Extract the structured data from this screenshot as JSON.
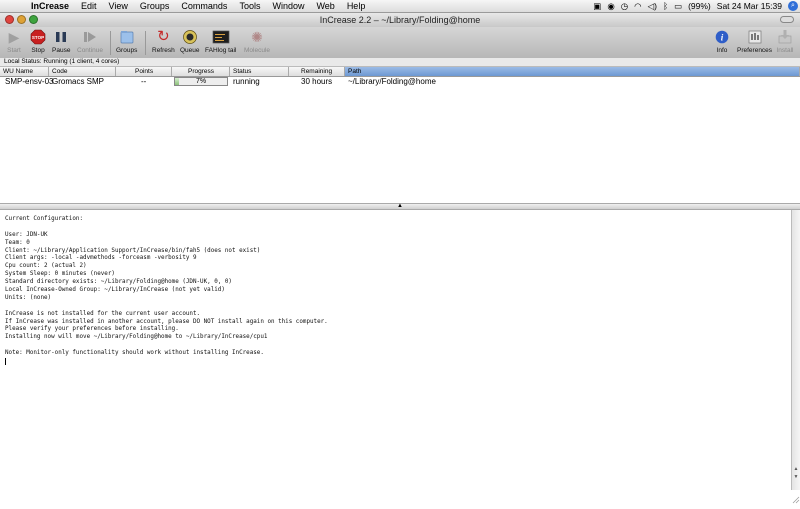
{
  "menubar": {
    "app": "InCrease",
    "items": [
      "Edit",
      "View",
      "Groups",
      "Commands",
      "Tools",
      "Window",
      "Web",
      "Help"
    ],
    "battery": "(99%)",
    "clock": "Sat 24 Mar 15:39"
  },
  "window": {
    "title": "InCrease 2.2 – ~/Library/Folding@home"
  },
  "toolbar": {
    "start": "Start",
    "stop": "Stop",
    "pause": "Pause",
    "continue": "Continue",
    "groups": "Groups",
    "refresh": "Refresh",
    "queue": "Queue",
    "fahlog": "FAHlog tail",
    "molecule": "Molecule",
    "info": "Info",
    "preferences": "Preferences",
    "install": "Install"
  },
  "local_status": "Local Status: Running (1 client, 4 cores)",
  "table": {
    "headers": [
      "WU Name",
      "Code",
      "Points",
      "Progress",
      "Status",
      "Remaining",
      "Path"
    ],
    "rows": [
      {
        "wu_name": "SMP-ensv-03",
        "code": "Gromacs SMP",
        "points": "--",
        "progress_label": "7%",
        "progress_fraction": 0.07,
        "status": "running",
        "remaining": "30 hours",
        "path": "~/Library/Folding@home"
      }
    ]
  },
  "console": {
    "lines": [
      "Current Configuration:",
      "",
      "User: JDN-UK",
      "Team: 0",
      "Client: ~/Library/Application Support/InCrease/bin/fah5 (does not exist)",
      "Client args: -local -advmethods -forceasm -verbosity 9",
      "Cpu count: 2 (actual 2)",
      "System Sleep: 0 minutes (never)",
      "Standard directory exists: ~/Library/Folding@home (JDN-UK, 0, 0)",
      "Local InCrease-Owned Group: ~/Library/InCrease (not yet valid)",
      "Units: (none)",
      "",
      "InCrease is not installed for the current user account.",
      "If InCrease was installed in another account, please DO NOT install again on this computer.",
      "Please verify your preferences before installing.",
      "Installing now will move ~/Library/Folding@home to ~/Library/InCrease/cpu1",
      "",
      "Note: Monitor-only functionality should work without installing InCrease."
    ]
  }
}
